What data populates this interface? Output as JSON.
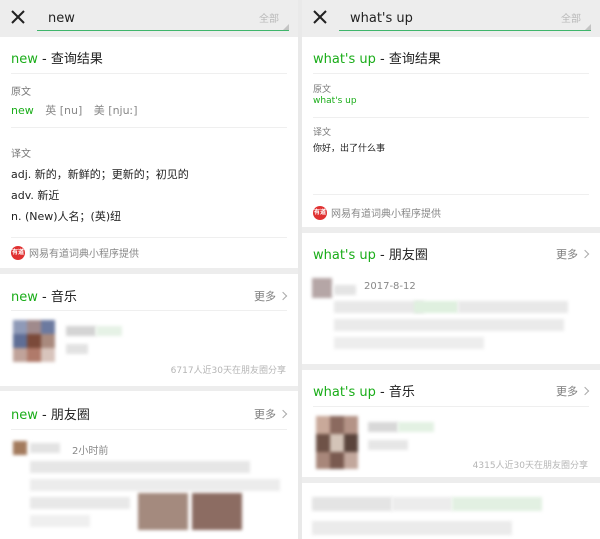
{
  "left": {
    "search_value": "new",
    "scope_label": "全部",
    "dict": {
      "keyword": "new",
      "title_suffix": " - 查询结果",
      "source_label": "原文",
      "source_word": "new",
      "phonetic_uk": "英 [nu]",
      "phonetic_us": "美 [njuː]",
      "translation_label": "译文",
      "meanings": [
        "adj. 新的，新鲜的；更新的；初见的",
        "adv. 新近",
        "n. (New)人名；(英)纽"
      ],
      "provider": "网易有道词典小程序提供"
    },
    "music": {
      "keyword": "new",
      "title_suffix": " - 音乐",
      "more_label": "更多",
      "stats": "6717人近30天在朋友圈分享"
    },
    "moments": {
      "keyword": "new",
      "title_suffix": " - 朋友圈",
      "more_label": "更多",
      "time": "2小时前"
    }
  },
  "right": {
    "search_value": "what's up",
    "scope_label": "全部",
    "dict": {
      "keyword": "what's up",
      "title_suffix": " - 查询结果",
      "source_label": "原文",
      "source_word": "what's up",
      "translation_label": "译文",
      "translation": "你好，出了什么事",
      "provider": "网易有道词典小程序提供"
    },
    "moments": {
      "keyword": "what's up",
      "title_suffix": " - 朋友圈",
      "more_label": "更多",
      "time": "2017-8-12"
    },
    "music": {
      "keyword": "what's up",
      "title_suffix": " - 音乐",
      "more_label": "更多",
      "stats": "4315人近30天在朋友圈分享"
    }
  },
  "provider_logo_text": "有道",
  "icons": {
    "close": "close-icon",
    "chevron": "chevron-right-icon",
    "provider": "youdao-logo-icon"
  },
  "colors": {
    "accent_green": "#1aad19",
    "search_underline": "#3fb56b",
    "provider_red": "#e03131"
  }
}
